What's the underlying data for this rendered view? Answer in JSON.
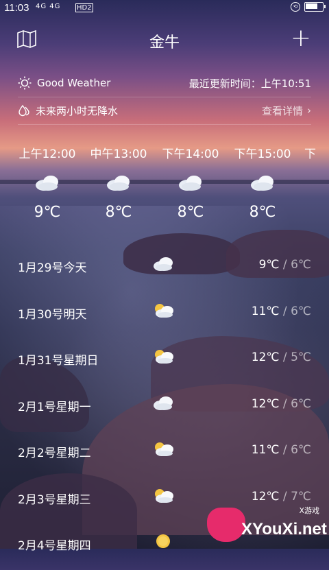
{
  "status_bar": {
    "time": "11:03",
    "signal": "4G 4G",
    "network": "HD2"
  },
  "header": {
    "city": "金牛",
    "add_label": "+"
  },
  "info": {
    "weather_text": "Good Weather",
    "updated": "最近更新时间：上午10:51",
    "rain_text": "未来两小时无降水",
    "details_label": "查看详情"
  },
  "hourly": [
    {
      "time": "上午12:00",
      "temp": "9℃"
    },
    {
      "time": "中午13:00",
      "temp": "8℃"
    },
    {
      "time": "下午14:00",
      "temp": "8℃"
    },
    {
      "time": "下午15:00",
      "temp": "8℃"
    },
    {
      "time": "下",
      "temp": ""
    }
  ],
  "daily": [
    {
      "name": "1月29号今天",
      "high": "9℃",
      "low": "6℃",
      "icon": "cloudy-icon"
    },
    {
      "name": "1月30号明天",
      "high": "11℃",
      "low": "6℃",
      "icon": "partly-cloudy-icon"
    },
    {
      "name": "1月31号星期日",
      "high": "12℃",
      "low": "5℃",
      "icon": "partly-cloudy-icon"
    },
    {
      "name": "2月1号星期一",
      "high": "12℃",
      "low": "6℃",
      "icon": "cloudy-icon"
    },
    {
      "name": "2月2号星期二",
      "high": "11℃",
      "low": "6℃",
      "icon": "partly-cloudy-icon"
    },
    {
      "name": "2月3号星期三",
      "high": "12℃",
      "low": "7℃",
      "icon": "partly-cloudy-icon"
    },
    {
      "name": "2月4号星期四",
      "high": "",
      "low": "",
      "icon": "sunny-icon"
    }
  ],
  "watermark": {
    "text": "XYouXi.net",
    "small": "X游戏"
  }
}
